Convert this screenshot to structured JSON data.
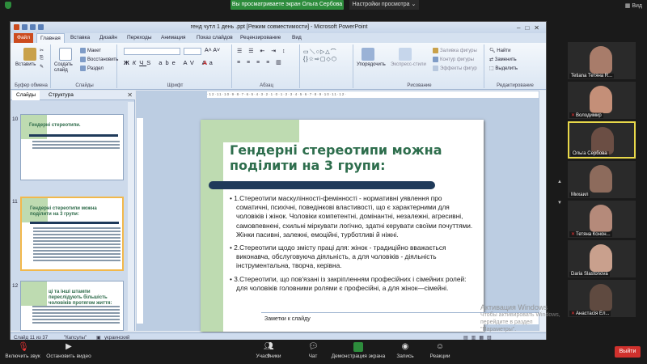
{
  "zoom": {
    "share_banner": "Вы просматриваете экран Ольга Сербова",
    "view_options": "Настройки просмотра ⌄",
    "view_button": "Вид",
    "participants": [
      {
        "name": "Tetiana Тетяна R...",
        "muted": false
      },
      {
        "name": "Володимир",
        "muted": true
      },
      {
        "name": "Ольга Сербова",
        "muted": false,
        "active": true
      },
      {
        "name": "Михаил",
        "muted": false
      },
      {
        "name": "Тетяна Конон...",
        "muted": true
      },
      {
        "name": "Daria Slastonova",
        "muted": false
      },
      {
        "name": "Анастасія Ел...",
        "muted": true
      }
    ],
    "scroll_count": "1/2",
    "bottom": {
      "mute": "Включить звук",
      "video": "Остановить видео",
      "participants": "Участники",
      "participants_count": "9",
      "chat": "Чат",
      "share": "Демонстрация экрана",
      "record": "Запись",
      "reactions": "Реакции",
      "exit": "Выйти"
    }
  },
  "ppt": {
    "window_title": "генд чутл 1 день .ppt [Режим совместимости] - Microsoft PowerPoint",
    "tabs": [
      "Файл",
      "Главная",
      "Вставка",
      "Дизайн",
      "Переходы",
      "Анимация",
      "Показ слайдов",
      "Рецензирование",
      "Вид"
    ],
    "ribbon": {
      "paste": "Вставить",
      "clipboard": "Буфер обмена",
      "create_slide": "Создать слайд",
      "layout": "Макет",
      "reset": "Восстановить",
      "section": "Раздел",
      "slides_group": "Слайды",
      "font_group": "Шрифт",
      "paragraph_group": "Абзац",
      "arrange": "Упорядочить",
      "quick_styles": "Экспресс-стили",
      "fill": "Заливка фигуры",
      "outline": "Контур фигуры",
      "effects": "Эффекты фигур",
      "drawing_group": "Рисование",
      "find": "Найти",
      "replace": "Заменить",
      "select": "Выделить",
      "editing_group": "Редактирование"
    },
    "panel_tabs": [
      "Слайды",
      "Структура"
    ],
    "thumbnails": [
      {
        "num": "10",
        "title": "Гендерні стереотипи."
      },
      {
        "num": "11",
        "title": "Гендерні стереотипи можна поділити на 3 групи:"
      },
      {
        "num": "12",
        "title": "ці та інші штампи переслідують більшість чоловіків протягом життя:"
      }
    ],
    "slide": {
      "title": "Гендерні стереотипи можна поділити на 3 групи:",
      "points": [
        "1.Стереотипи маскулінності-фемінності - нормативні уявлення про соматичні, психічні, поведінкові властивості, що є характерними для чоловіків і жінок. Чоловіки компетентні, домінантні, незалежні, агресивні, самовпевнені, схильні міркувати логічно, здатні керувати своїми почуттями. Жінки пасивні, залежні, емоційні, турботливі й ніжні.",
        "2.Стереотипи щодо змісту праці для: жінок - традиційно вважається виконавча, обслуговуюча діяльність, а для чоловіків - діяльність інструментальна, творча, керівна.",
        "3.Стереотипи, що пов'язані із закріпленням професійних і сімейних ролей: для чоловіків головними ролями є професійні, а для жінок—сімейні."
      ]
    },
    "notes_placeholder": "Заметки к слайду",
    "status": {
      "slide_of": "Слайд 11 из 37",
      "theme": "\"Капсулы\"",
      "language": "украинский"
    },
    "watermark_line1": "Активация Windows",
    "watermark_line2": "Чтобы активировать Windows, перейдите в раздел \"Параметры\"."
  }
}
